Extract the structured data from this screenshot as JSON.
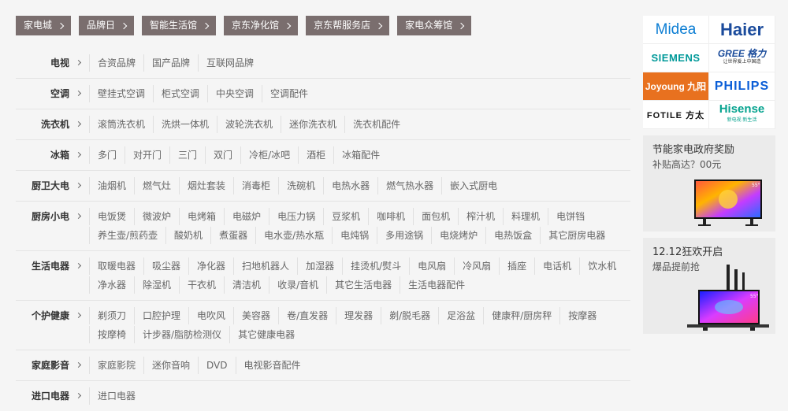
{
  "tags": [
    {
      "label": "家电城"
    },
    {
      "label": "品牌日"
    },
    {
      "label": "智能生活馆"
    },
    {
      "label": "京东净化馆"
    },
    {
      "label": "京东帮服务店"
    },
    {
      "label": "家电众筹馆"
    }
  ],
  "categories": [
    {
      "title": "电视",
      "items": [
        "合资品牌",
        "国产品牌",
        "互联网品牌"
      ]
    },
    {
      "title": "空调",
      "items": [
        "壁挂式空调",
        "柜式空调",
        "中央空调",
        "空调配件"
      ]
    },
    {
      "title": "洗衣机",
      "items": [
        "滚筒洗衣机",
        "洗烘一体机",
        "波轮洗衣机",
        "迷你洗衣机",
        "洗衣机配件"
      ]
    },
    {
      "title": "冰箱",
      "items": [
        "多门",
        "对开门",
        "三门",
        "双门",
        "冷柜/冰吧",
        "酒柜",
        "冰箱配件"
      ]
    },
    {
      "title": "厨卫大电",
      "items": [
        "油烟机",
        "燃气灶",
        "烟灶套装",
        "消毒柜",
        "洗碗机",
        "电热水器",
        "燃气热水器",
        "嵌入式厨电"
      ]
    },
    {
      "title": "厨房小电",
      "items": [
        "电饭煲",
        "微波炉",
        "电烤箱",
        "电磁炉",
        "电压力锅",
        "豆浆机",
        "咖啡机",
        "面包机",
        "榨汁机",
        "料理机",
        "电饼铛",
        "养生壶/煎药壶",
        "酸奶机",
        "煮蛋器",
        "电水壶/热水瓶",
        "电炖锅",
        "多用途锅",
        "电烧烤炉",
        "电热饭盒",
        "其它厨房电器"
      ]
    },
    {
      "title": "生活电器",
      "items": [
        "取暖电器",
        "吸尘器",
        "净化器",
        "扫地机器人",
        "加湿器",
        "挂烫机/熨斗",
        "电风扇",
        "冷风扇",
        "插座",
        "电话机",
        "饮水机",
        "净水器",
        "除湿机",
        "干衣机",
        "清洁机",
        "收录/音机",
        "其它生活电器",
        "生活电器配件"
      ]
    },
    {
      "title": "个护健康",
      "items": [
        "剃须刀",
        "口腔护理",
        "电吹风",
        "美容器",
        "卷/直发器",
        "理发器",
        "剃/脱毛器",
        "足浴盆",
        "健康秤/厨房秤",
        "按摩器",
        "按摩椅",
        "计步器/脂肪检测仪",
        "其它健康电器"
      ]
    },
    {
      "title": "家庭影音",
      "items": [
        "家庭影院",
        "迷你音响",
        "DVD",
        "电视影音配件"
      ]
    },
    {
      "title": "进口电器",
      "items": [
        "进口电器"
      ]
    }
  ],
  "brands": {
    "midea": "Midea",
    "haier": "Haier",
    "siemens": "SIEMENS",
    "gree": "GREE 格力",
    "gree_tagline": "让世界爱上中国造",
    "joyoung": "Joyoung 九阳",
    "philips": "PHILIPS",
    "fotile": "FOTILE 方太",
    "hisense": "Hisense",
    "hisense_tagline": "新电视  新生活"
  },
  "promos": [
    {
      "title": "节能家电政府奖励",
      "subtitle": "补贴高达？00元",
      "tv_badge": "55\""
    },
    {
      "title": "12.12狂欢开启",
      "subtitle": "爆品提前抢",
      "tv_badge": "55\""
    }
  ],
  "colors": {
    "tag_bg": "#7a6e6e",
    "page_bg": "#f5f5f5"
  }
}
